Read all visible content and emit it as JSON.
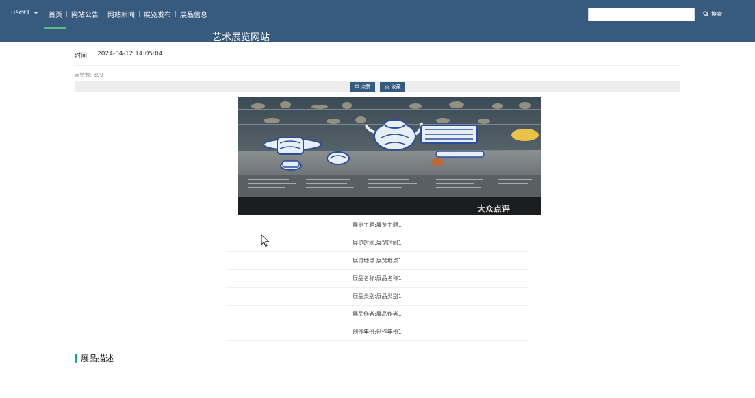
{
  "header": {
    "user_label": "user1",
    "nav": [
      "首页",
      "网站公告",
      "网站新闻",
      "展览发布",
      "展品信息"
    ],
    "site_title": "艺术展览网站",
    "search_placeholder": "",
    "search_label": "搜索"
  },
  "meta": {
    "time_label": "时间:",
    "time_value": "2024-04-12 14:05:04",
    "views": "点赞数: 899"
  },
  "actions": {
    "like_label": "点赞",
    "favorite_label": "收藏"
  },
  "picture": {
    "watermark": "大众点评"
  },
  "info": [
    "展览主题:展览主题1",
    "展览时间:展览时间1",
    "展览地点:展览地点1",
    "展品名称:展品名称1",
    "展品类别:展品类别1",
    "展品作者:展品作者1",
    "创作年份:创作年份1"
  ],
  "description": {
    "heading": "展品描述"
  },
  "colors": {
    "topbar": "#375a7f",
    "accent": "#19a39a",
    "active_underline": "#5cb88a"
  }
}
